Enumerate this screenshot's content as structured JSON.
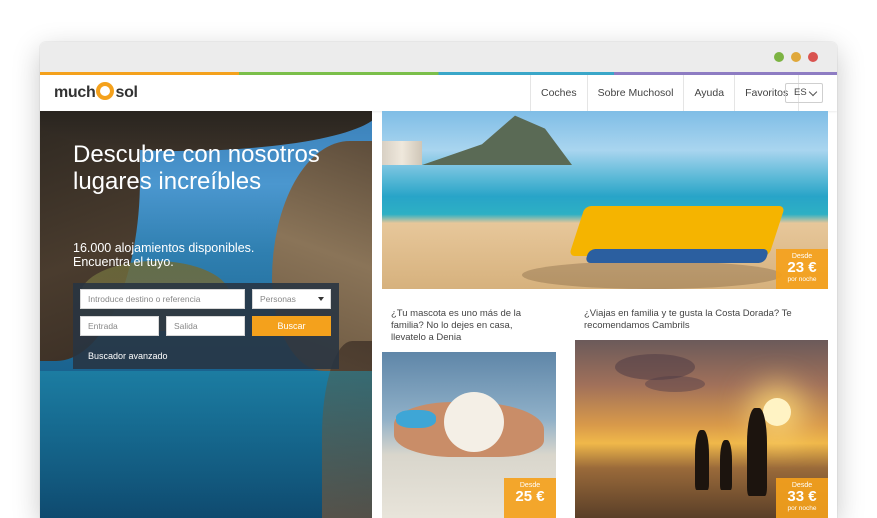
{
  "brand": {
    "logo_pre": "much",
    "logo_mid": "o",
    "logo_post": "sol"
  },
  "nav": {
    "links": [
      "Coches",
      "Sobre Muchosol",
      "Ayuda",
      "Favoritos"
    ],
    "language": "ES"
  },
  "hero": {
    "title": "Descubre con nosotros lugares increíbles",
    "subtitle_line1": "16.000 alojamientos disponibles.",
    "subtitle_line2": "Encuentra el tuyo.",
    "search": {
      "destination_placeholder": "Introduce destino o referencia",
      "persons_placeholder": "Personas",
      "checkin_placeholder": "Entrada",
      "checkout_placeholder": "Salida",
      "search_button": "Buscar",
      "advanced_link": "Buscador avanzado"
    }
  },
  "cards": [
    {
      "title": "",
      "price_from": "Desde",
      "price": "23 €",
      "per_night": "por noche"
    },
    {
      "title": "¿Tu mascota es uno más de la familia? No lo dejes en casa, llevatelo a Denia",
      "price_from": "Desde",
      "price": "25 €",
      "per_night": ""
    },
    {
      "title": "¿Viajas en familia y te gusta la Costa Dorada? Te recomendamos Cambrils",
      "price_from": "Desde",
      "price": "33 €",
      "per_night": "por noche"
    }
  ],
  "colors": {
    "accent": "#f4a11c",
    "window_controls": [
      "#7cb342",
      "#e0a83a",
      "#d9534f"
    ]
  },
  "icons": {
    "language_dropdown": "chevron-down-icon",
    "persons_dropdown": "caret-down-icon"
  }
}
